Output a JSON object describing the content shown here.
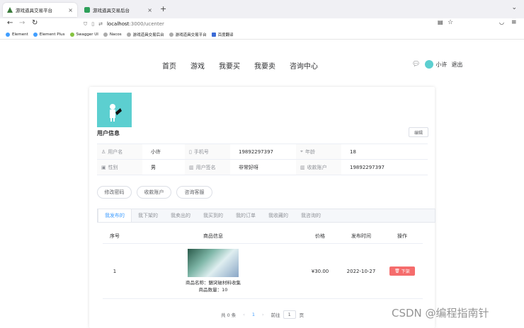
{
  "browser": {
    "tabs": [
      {
        "title": "游戏道具交易平台",
        "active": true
      },
      {
        "title": "游戏道具交易后台",
        "active": false
      }
    ],
    "url_host": "localhost",
    "url_path": ":3000/ucenter",
    "bookmarks": [
      "Element",
      "Element Plus",
      "Swagger UI",
      "Nacos",
      "游戏道具交易后台",
      "游戏道具交易平台",
      "百度翻译"
    ]
  },
  "nav": {
    "items": [
      "首页",
      "游戏",
      "我要买",
      "我要卖",
      "咨询中心"
    ],
    "username": "小许",
    "logout": "退出"
  },
  "profile": {
    "title": "用户信息",
    "edit": "编辑",
    "rows": [
      [
        {
          "label": "用户名",
          "value": "小许"
        },
        {
          "label": "手机号",
          "value": "19892297397"
        },
        {
          "label": "年龄",
          "value": "18"
        }
      ],
      [
        {
          "label": "性别",
          "value": "男"
        },
        {
          "label": "用户签名",
          "value": "非常好呀"
        },
        {
          "label": "收款账户",
          "value": "19892297397"
        }
      ]
    ],
    "actions": [
      "修改密码",
      "收款账户",
      "咨询客服"
    ]
  },
  "tabs": [
    "我发布的",
    "我下架的",
    "我卖出的",
    "我买到的",
    "我的订单",
    "我收藏的",
    "我咨询的"
  ],
  "table": {
    "headers": [
      "序号",
      "商品信息",
      "价格",
      "发布时间",
      "操作"
    ],
    "rows": [
      {
        "index": "1",
        "name": "商品名称：魑突破材料收集",
        "qty": "商品数量：10",
        "price": "¥30.00",
        "date": "2022-10-27",
        "action": "下架"
      }
    ]
  },
  "pagination": {
    "total": "共 0 条",
    "page": "1",
    "goto": "前往",
    "goto_value": "1",
    "page_unit": "页"
  },
  "watermark": "CSDN @编程指南针",
  "colors": {
    "accent": "#409eff",
    "danger": "#f56c6c",
    "avatar": "#5ccfd0"
  }
}
